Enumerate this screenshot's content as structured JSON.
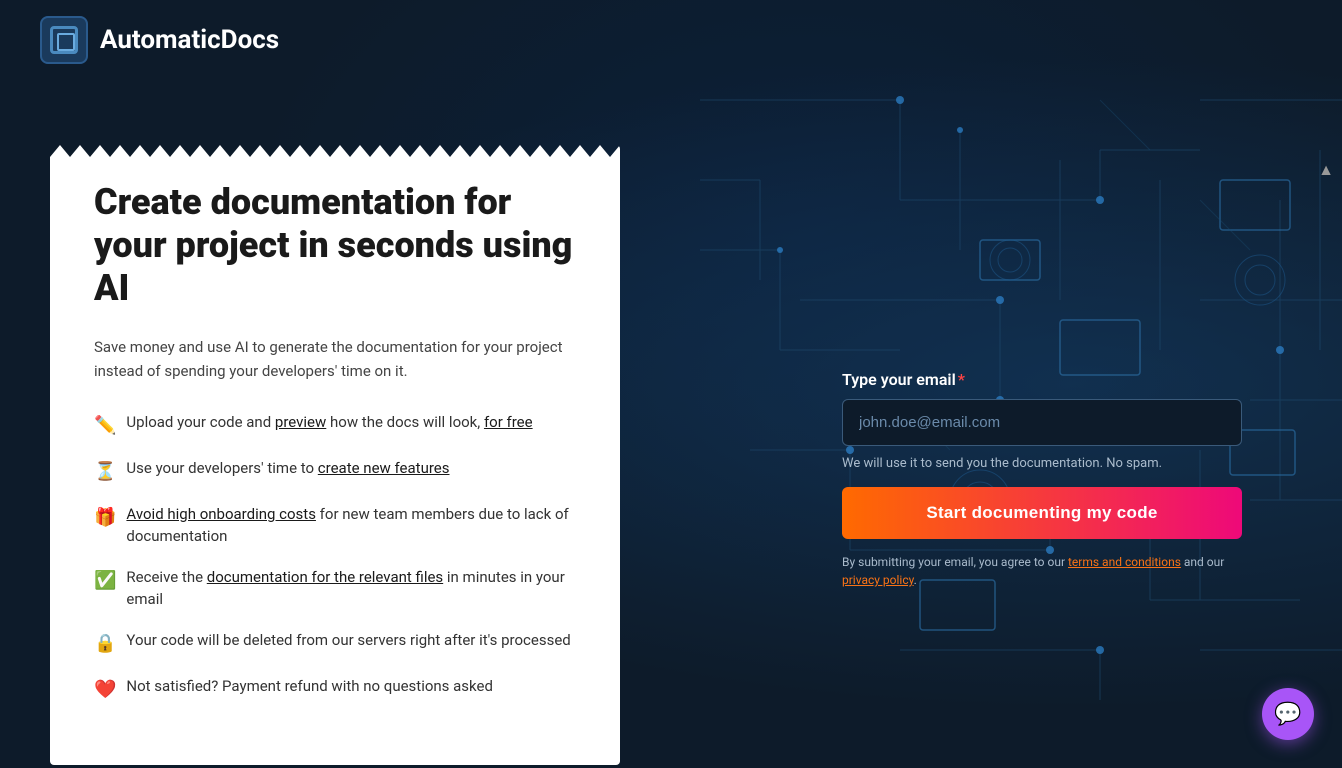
{
  "brand": {
    "name": "AutomaticDocs",
    "logo_alt": "AutomaticDocs logo"
  },
  "hero": {
    "title": "Create documentation for your project in seconds using AI",
    "subtitle": "Save money and use AI to generate the documentation for your project instead of spending your developers' time on it.",
    "features": [
      {
        "emoji": "✏️",
        "text_before": "Upload your code and ",
        "link_text": "preview",
        "text_middle": " how the docs will look, ",
        "link2_text": "for free",
        "text_after": ""
      },
      {
        "emoji": "⏳",
        "text_before": "Use your developers' time to ",
        "link_text": "create new features",
        "text_after": ""
      },
      {
        "emoji": "🎁",
        "text_before": "",
        "link_text": "Avoid high onboarding costs",
        "text_after": " for new team members due to lack of documentation"
      },
      {
        "emoji": "✅",
        "text_before": "Receive the ",
        "link_text": "documentation for the relevant files",
        "text_after": " in minutes in your email"
      },
      {
        "emoji": "🔒",
        "text_before": "Your code will be deleted from our servers right after it's processed",
        "link_text": "",
        "text_after": ""
      },
      {
        "emoji": "❤️",
        "text_before": "Not satisfied? Payment refund with no questions asked",
        "link_text": "",
        "text_after": ""
      }
    ]
  },
  "form": {
    "email_label": "Type your email",
    "email_required": "*",
    "email_placeholder": "john.doe@email.com",
    "no_spam_text": "We will use it to send you the documentation. No spam.",
    "cta_button": "Start documenting my code",
    "terms_text_before": "By submitting your email, you agree to our ",
    "terms_link": "terms and conditions",
    "terms_text_middle": " and our ",
    "privacy_link": "privacy policy",
    "terms_text_after": "."
  },
  "chat": {
    "icon": "💬"
  }
}
